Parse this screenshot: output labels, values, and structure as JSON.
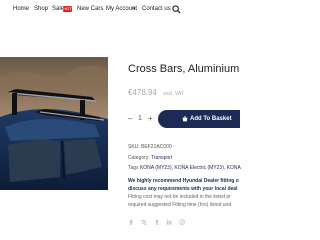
{
  "nav": {
    "home": "Home",
    "shop": "Shop",
    "sale": "Sale",
    "sale_badge": "HOT",
    "new_cars": "New Cars",
    "my_account": "My Account",
    "contact": "Contact us"
  },
  "product": {
    "title": "Cross Bars, Aluminium",
    "price": "€478.94",
    "vat_note": "excl. VAT",
    "quantity": "1",
    "add_to_basket": "Add To Basket",
    "sku_label": "SKU:",
    "sku": "BEF21AC000",
    "category_label": "Category:",
    "category": "Transport",
    "tags_label": "Tags",
    "tags": "KONA (MY23), KONA Electric (MY23), KONA",
    "description_lines": [
      "We highly recommend Hyundai Dealer fitting o",
      "discuss any requirements with your local deal",
      "Fitting cost may not be included in the listed pr",
      "required suggested Fitting time (hrs) listed und"
    ]
  },
  "colors": {
    "accent": "#1d2a55",
    "sale_badge": "#e3242b",
    "muted": "#aaaaaa"
  },
  "icons": {
    "search": "search-icon",
    "basket": "basket-icon",
    "share": [
      "facebook-icon",
      "twitter-icon",
      "tumblr-icon",
      "linkedin-icon",
      "pinterest-icon"
    ]
  }
}
